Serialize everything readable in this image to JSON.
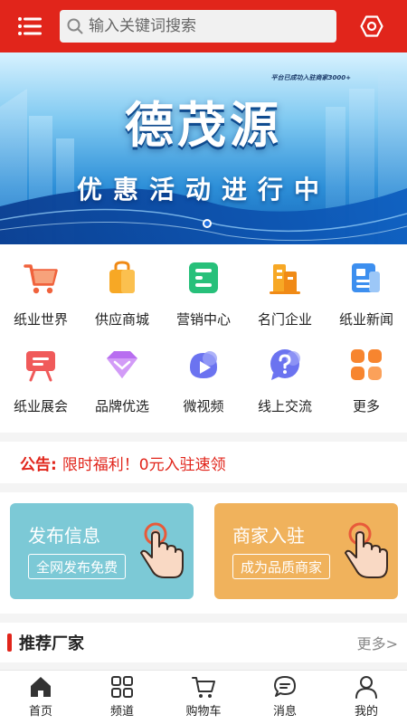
{
  "header": {
    "search_placeholder": "输入关键词搜索",
    "icons": {
      "menu": "menu-icon",
      "search": "search-icon",
      "settings": "hexagon-settings-icon"
    },
    "accent": "#e1251b"
  },
  "banner": {
    "top_text": "平台已成功入驻商家3000+",
    "title": "德茂源",
    "slogan": "优惠活动进行中",
    "slide_count": 1,
    "active_slide": 1
  },
  "categories": [
    {
      "label": "纸业世界",
      "icon": "cart-icon"
    },
    {
      "label": "供应商城",
      "icon": "bag-icon"
    },
    {
      "label": "营销中心",
      "icon": "document-icon"
    },
    {
      "label": "名门企业",
      "icon": "building-icon"
    },
    {
      "label": "纸业新闻",
      "icon": "news-icon"
    },
    {
      "label": "纸业展会",
      "icon": "exhibition-board-icon"
    },
    {
      "label": "品牌优选",
      "icon": "diamond-icon"
    },
    {
      "label": "微视频",
      "icon": "video-play-icon"
    },
    {
      "label": "线上交流",
      "icon": "question-chat-icon"
    },
    {
      "label": "更多",
      "icon": "grid-more-icon"
    }
  ],
  "notice": {
    "prefix": "公告:",
    "text": "限时福利！0元入驻速领"
  },
  "actions": [
    {
      "title": "发布信息",
      "button": "全网发布免费",
      "color": "#7cc9d6",
      "icon": "hand-click-icon"
    },
    {
      "title": "商家入驻",
      "button": "成为品质商家",
      "color": "#f0b25c",
      "icon": "hand-click-icon"
    }
  ],
  "recommended": {
    "title": "推荐厂家",
    "more": "更多>"
  },
  "bottom_nav": [
    {
      "label": "首页",
      "icon": "home-icon"
    },
    {
      "label": "频道",
      "icon": "channel-grid-icon"
    },
    {
      "label": "购物车",
      "icon": "shopping-cart-icon"
    },
    {
      "label": "消息",
      "icon": "message-icon"
    },
    {
      "label": "我的",
      "icon": "user-icon"
    }
  ]
}
